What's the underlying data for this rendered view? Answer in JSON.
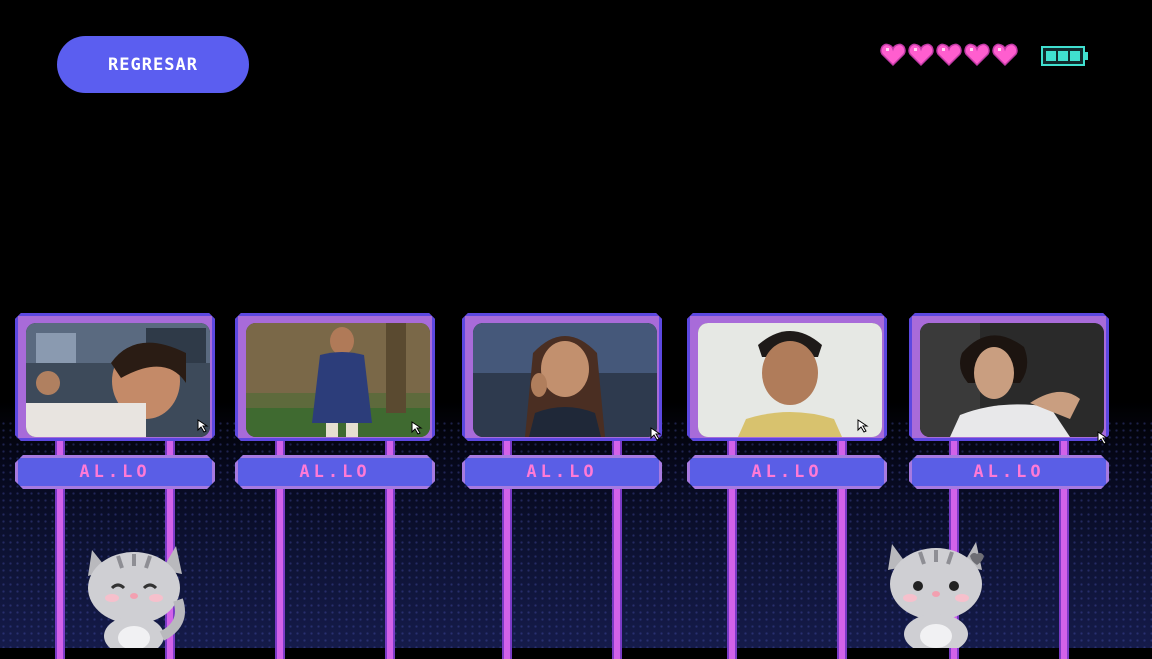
{
  "nav": {
    "back_label": "REGRESAR"
  },
  "status": {
    "hearts": 5,
    "heart_color": "#ff5ecf",
    "battery_icon": "battery-full-icon",
    "battery_color": "#40e0d0"
  },
  "boards": [
    {
      "label": "AL.LO",
      "photo": "photo-young-man-selfie"
    },
    {
      "label": "AL.LO",
      "photo": "photo-man-blue-shirt"
    },
    {
      "label": "AL.LO",
      "photo": "photo-young-woman"
    },
    {
      "label": "AL.LO",
      "photo": "photo-young-man-yellow-shirt"
    },
    {
      "label": "AL.LO",
      "photo": "photo-young-man-curly-hair"
    }
  ],
  "colors": {
    "accent": "#5b5ef0",
    "frame": "#a86bd9",
    "post": "#d262e9",
    "label": "#ff7ad6"
  }
}
